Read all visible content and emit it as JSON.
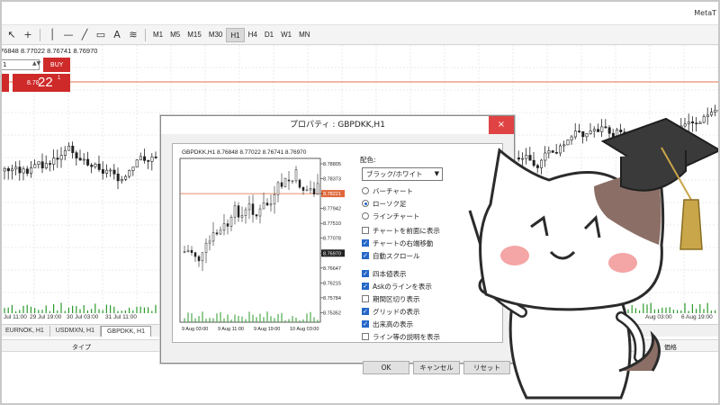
{
  "app": {
    "title": "MetaT"
  },
  "toolbar": {
    "timeframes": [
      {
        "label": "M1",
        "active": false
      },
      {
        "label": "M5",
        "active": false
      },
      {
        "label": "M15",
        "active": false
      },
      {
        "label": "M30",
        "active": false
      },
      {
        "label": "H1",
        "active": true
      },
      {
        "label": "H4",
        "active": false
      },
      {
        "label": "D1",
        "active": false
      },
      {
        "label": "W1",
        "active": false
      },
      {
        "label": "MN",
        "active": false
      }
    ]
  },
  "chart": {
    "info": "76848 8.77022 8.76741 8.76970",
    "lot_value": "1",
    "buy_label": "BUY",
    "buy_price_small": "8.78",
    "buy_price_big": "22",
    "buy_price_sup": "1",
    "dates": [
      "Jul 11:00",
      "29 Jul 19:00",
      "30 Jul 03:00",
      "31 Jul 11:00",
      "Aug 03:00",
      "6 Aug 19:00"
    ],
    "colors": {
      "up": "#222222",
      "grid": "#e8e8e8",
      "price_line": "#e07050"
    }
  },
  "tabs": [
    {
      "label": "EURNOK, H1",
      "active": false
    },
    {
      "label": "USDMXN, H1",
      "active": false
    },
    {
      "label": "GBPDKK, H1",
      "active": true
    }
  ],
  "columns": {
    "type": "タイプ",
    "price": "価格"
  },
  "dialog": {
    "title": "プロパティ : GBPDKK,H1",
    "close_icon": "×",
    "preview": {
      "info": "GBPDKK,H1  8.76848 8.77022 8.76741 8.76970",
      "price_labels": [
        "8.78805",
        "8.78373",
        "8.78221",
        "8.77942",
        "8.77510",
        "8.77078",
        "8.76970",
        "8.76647",
        "8.76215",
        "8.75784",
        "8.75352"
      ],
      "highlight_label": "8.78221",
      "current_label": "8.76970",
      "dates": [
        "9 Aug 03:00",
        "9 Aug 11:00",
        "9 Aug 19:00",
        "10 Aug 03:00"
      ]
    },
    "color_label": "配色:",
    "color_scheme": "ブラック/ホワイト",
    "radios": [
      {
        "label": "バーチャート",
        "checked": false
      },
      {
        "label": "ローソク足",
        "checked": true
      },
      {
        "label": "ラインチャート",
        "checked": false
      }
    ],
    "checks_a": [
      {
        "label": "チャートを前面に表示",
        "checked": false
      },
      {
        "label": "チャートの右端移動",
        "checked": true
      },
      {
        "label": "自動スクロール",
        "checked": true
      }
    ],
    "checks_b": [
      {
        "label": "四本値表示",
        "checked": true
      },
      {
        "label": "Askのラインを表示",
        "checked": true
      },
      {
        "label": "期間区切り表示",
        "checked": false
      },
      {
        "label": "グリッドの表示",
        "checked": true
      },
      {
        "label": "出来高の表示",
        "checked": true
      },
      {
        "label": "ライン等の説明を表示",
        "checked": false
      }
    ],
    "buttons": {
      "ok": "OK",
      "cancel": "キャンセル",
      "reset": "リセット"
    }
  }
}
